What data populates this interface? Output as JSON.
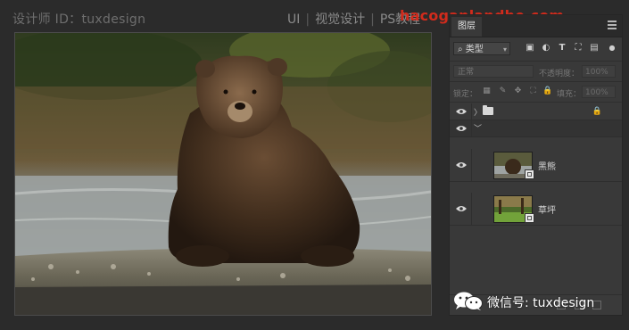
{
  "watermark": {
    "designer": "设计师 ID：tuxdesign",
    "nav_ui": "UI",
    "nav_visual": "视觉设计",
    "nav_ps": "PS教程",
    "url": "hacoganlandhe.com"
  },
  "panel": {
    "tab_label": "图层",
    "filter_kind": "类型",
    "blend_mode": "正常",
    "opacity_label": "不透明度：",
    "opacity_value": "100%",
    "lock_label": "锁定：",
    "fill_label": "填充：",
    "fill_value": "100%"
  },
  "layers": [
    {
      "type": "group",
      "visible": true,
      "locked": true
    },
    {
      "type": "group-expanded",
      "visible": true
    },
    {
      "type": "image",
      "name": "黑熊",
      "visible": true
    },
    {
      "type": "image",
      "name": "草坪",
      "visible": true
    }
  ],
  "footer": {
    "wechat_text": "微信号: tuxdesign"
  },
  "icons": [
    "search-icon",
    "image-filter-icon",
    "adjustment-filter-icon",
    "type-filter-icon",
    "shape-filter-icon",
    "smart-object-filter-icon",
    "eye-icon",
    "folder-icon",
    "lock-icon",
    "panel-menu-icon",
    "wechat-icon"
  ],
  "colors": {
    "panel_bg": "#393939",
    "watermark_red": "#d12b1c",
    "app_bg": "#2b2b2b"
  }
}
